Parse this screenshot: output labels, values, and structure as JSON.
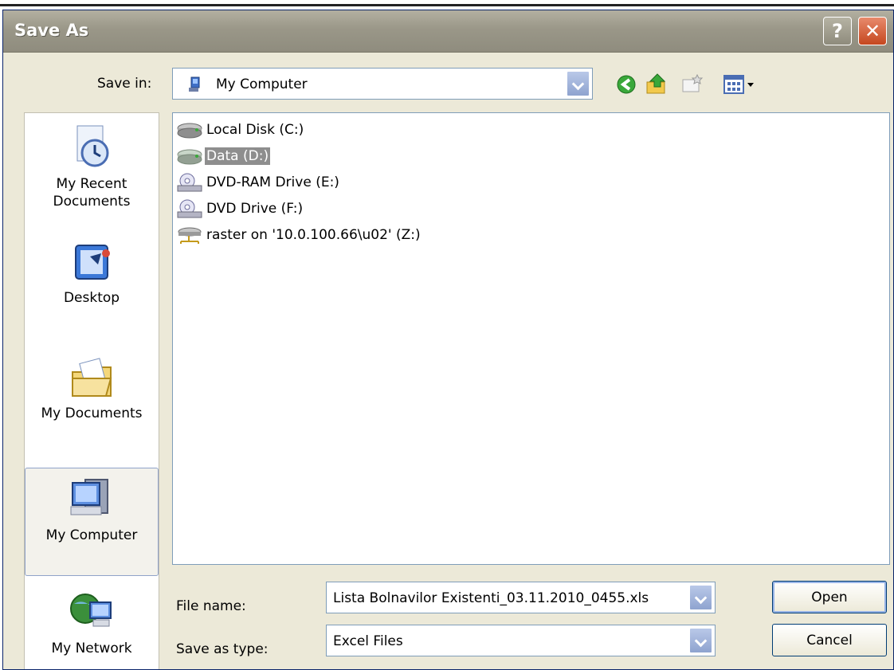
{
  "window": {
    "title": "Save As",
    "help_glyph": "?",
    "close_glyph": "✕"
  },
  "toolbar": {
    "save_in_label": "Save in:",
    "save_in_value": "My Computer",
    "save_in_icon": "my-computer-icon",
    "buttons": [
      "back-icon",
      "up-folder-icon",
      "new-folder-icon",
      "views-icon"
    ]
  },
  "places": [
    {
      "label": "My Recent Documents",
      "icon": "recent-documents-icon"
    },
    {
      "label": "Desktop",
      "icon": "desktop-icon"
    },
    {
      "label": "My Documents",
      "icon": "my-documents-icon"
    },
    {
      "label": "My Computer",
      "icon": "my-computer-icon",
      "selected": true
    },
    {
      "label": "My Network",
      "icon": "network-icon"
    }
  ],
  "files": [
    {
      "name": "Local Disk (C:)",
      "icon": "hard-drive-icon"
    },
    {
      "name": "Data (D:)",
      "icon": "hard-drive-icon",
      "selected": true
    },
    {
      "name": "DVD-RAM Drive (E:)",
      "icon": "dvd-drive-icon"
    },
    {
      "name": "DVD Drive (F:)",
      "icon": "dvd-drive-icon"
    },
    {
      "name": "raster on '10.0.100.66\\u02' (Z:)",
      "icon": "network-drive-icon"
    }
  ],
  "form": {
    "file_name_label": "File name:",
    "file_name_value": "Lista Bolnavilor Existenti_03.11.2010_0455.xls",
    "save_type_label": "Save as type:",
    "save_type_value": "Excel Files"
  },
  "buttons": {
    "open": "Open",
    "cancel": "Cancel"
  },
  "colors": {
    "accent": "#0a246a",
    "selection": "#8e8e8e"
  }
}
